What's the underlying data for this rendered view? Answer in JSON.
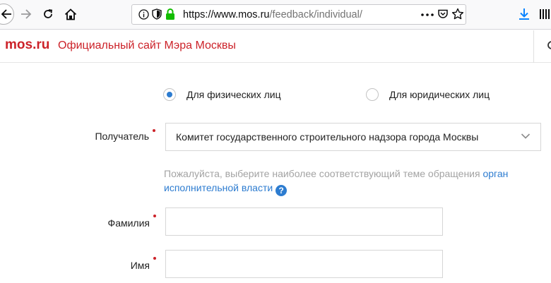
{
  "browser": {
    "url_host": "https://www.mos.ru",
    "url_path": "/feedback/individual/"
  },
  "site": {
    "logo": "mos.ru",
    "title": "Официальный сайт Мэра Москвы",
    "brand_color": "#cc2229"
  },
  "form": {
    "applicant_type": {
      "options": [
        {
          "label": "Для физических лиц",
          "selected": true
        },
        {
          "label": "Для юридических лиц",
          "selected": false
        }
      ]
    },
    "recipient": {
      "label": "Получатель",
      "value": "Комитет государственного строительного надзора города Москвы",
      "required": true
    },
    "hint": {
      "text": "Пожалуйста, выберите наиболее соответствующий теме обращения",
      "link": "орган исполнительной власти"
    },
    "last_name": {
      "label": "Фамилия",
      "value": "",
      "required": true
    },
    "first_name": {
      "label": "Имя",
      "value": "",
      "required": true
    }
  },
  "colors": {
    "accent": "#2d7cd0",
    "required": "#cc2229"
  }
}
